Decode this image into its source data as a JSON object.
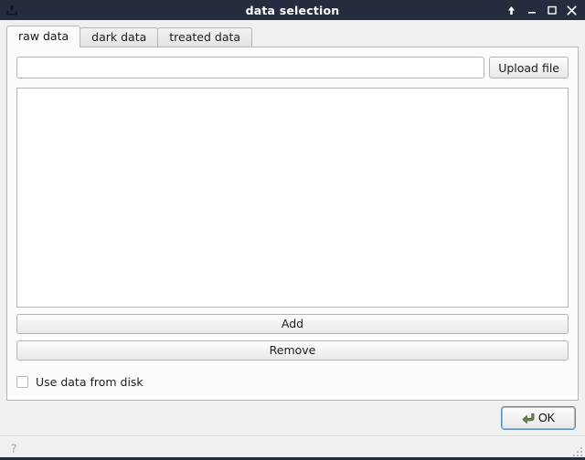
{
  "window": {
    "title": "data selection",
    "app_icon": "upload-tray-icon",
    "controls": [
      {
        "name": "shade-button",
        "glyph": "↑"
      },
      {
        "name": "minimize-button",
        "glyph": "–"
      },
      {
        "name": "maximize-button",
        "glyph": "□"
      },
      {
        "name": "close-button",
        "glyph": "✕"
      }
    ],
    "titlebar_bg": "#232d3d",
    "titlebar_fg": "#ffffff"
  },
  "tabs": [
    {
      "label": "raw data",
      "active": true
    },
    {
      "label": "dark data",
      "active": false
    },
    {
      "label": "treated data",
      "active": false
    }
  ],
  "panel": {
    "path_field": {
      "value": "",
      "placeholder": ""
    },
    "upload_button": "Upload file",
    "file_list": {
      "items": [],
      "empty": true
    },
    "add_button": "Add",
    "remove_button": "Remove",
    "use_disk_checkbox": {
      "label": "Use data from disk",
      "checked": false
    }
  },
  "actions": {
    "ok_button": "OK",
    "ok_icon": "enter-return-arrow-icon",
    "ok_icon_color": "#5f7a44",
    "ok_focus_color": "#5a8ec0"
  },
  "statusbar": {
    "help_icon": "question-mark-help-icon",
    "resize_grip": "resize-grip-icon"
  }
}
